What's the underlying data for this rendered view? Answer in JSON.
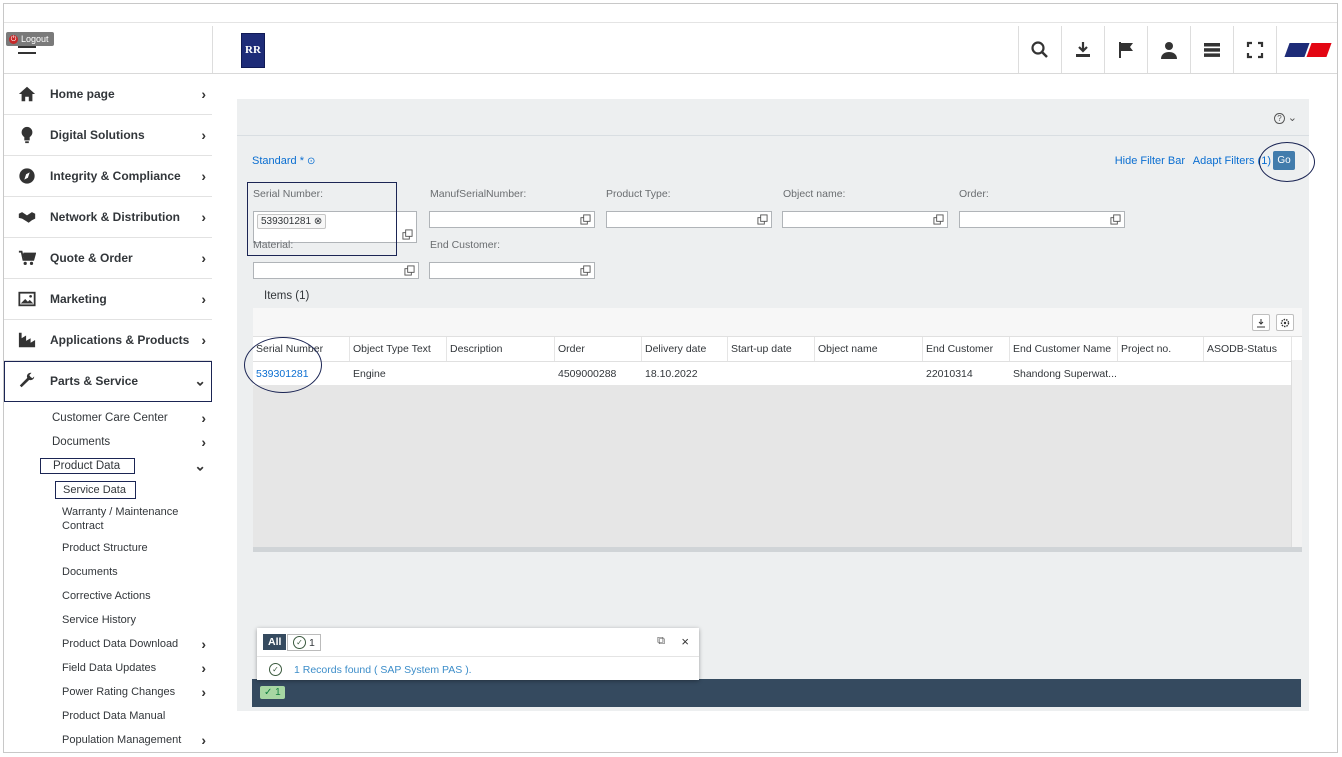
{
  "header": {
    "logout_label": "Logout",
    "icons": [
      "search-icon",
      "download-icon",
      "flag-icon",
      "user-icon",
      "list-icon",
      "fullscreen-icon"
    ]
  },
  "sidebar": {
    "items": [
      {
        "label": "Home page",
        "icon": "home-icon"
      },
      {
        "label": "Digital Solutions",
        "icon": "lightbulb-icon"
      },
      {
        "label": "Integrity & Compliance",
        "icon": "compass-icon"
      },
      {
        "label": "Network & Distribution",
        "icon": "handshake-icon"
      },
      {
        "label": "Quote & Order",
        "icon": "cart-icon"
      },
      {
        "label": "Marketing",
        "icon": "image-icon"
      },
      {
        "label": "Applications & Products",
        "icon": "chart-icon"
      },
      {
        "label": "Parts & Service",
        "icon": "wrench-icon"
      }
    ],
    "parts_sub": [
      {
        "label": "Customer Care Center"
      },
      {
        "label": "Documents"
      },
      {
        "label": "Product Data"
      }
    ],
    "product_data_sub": [
      {
        "label": "Service Data"
      },
      {
        "label": "Warranty / Maintenance Contract"
      },
      {
        "label": "Product Structure"
      },
      {
        "label": "Documents"
      },
      {
        "label": "Corrective Actions"
      },
      {
        "label": "Service History"
      },
      {
        "label": "Product Data Download"
      },
      {
        "label": "Field Data Updates"
      },
      {
        "label": "Power Rating Changes"
      },
      {
        "label": "Product Data Manual"
      },
      {
        "label": "Population Management"
      }
    ]
  },
  "filterbar": {
    "variant": "Standard *",
    "hide_label": "Hide Filter Bar",
    "adapt_label": "Adapt Filters (1)",
    "go_label": "Go",
    "fields": {
      "serial_label": "Serial Number:",
      "serial_token": "539301281",
      "manuf_label": "ManufSerialNumber:",
      "ptype_label": "Product Type:",
      "objname_label": "Object name:",
      "order_label": "Order:",
      "material_label": "Material:",
      "endcust_label": "End Customer:"
    }
  },
  "table": {
    "title": "Items (1)",
    "columns": [
      "Serial Number",
      "Object Type Text",
      "Description",
      "Order",
      "Delivery date",
      "Start-up date",
      "Object name",
      "End Customer",
      "End Customer Name",
      "Project no.",
      "ASODB-Status"
    ],
    "rows": [
      [
        "539301281",
        "Engine",
        "",
        "4509000288",
        "18.10.2022",
        "",
        "",
        "22010314",
        "Shandong Superwat...",
        "",
        ""
      ]
    ]
  },
  "messages": {
    "all_label": "All",
    "ok_count": "1",
    "message": "1 Records found ( SAP System PAS ).",
    "footer_count": "1"
  },
  "help": "?"
}
